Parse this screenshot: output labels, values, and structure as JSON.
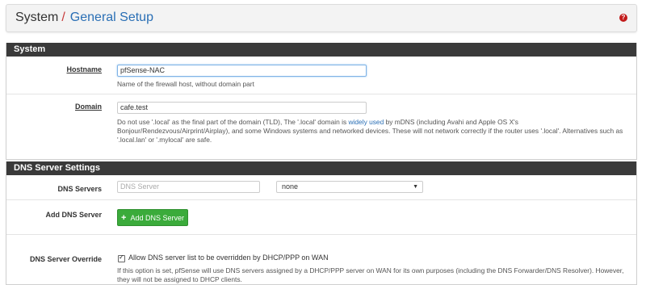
{
  "breadcrumb": {
    "root": "System",
    "separator": "/",
    "current": "General Setup"
  },
  "help_icon": "question-circle-icon",
  "system": {
    "heading": "System",
    "hostname": {
      "label": "Hostname",
      "value": "pfSense-NAC",
      "help": "Name of the firewall host, without domain part"
    },
    "domain": {
      "label": "Domain",
      "value": "cafe.test",
      "help_before_link": "Do not use '.local' as the final part of the domain (TLD), The '.local' domain is ",
      "help_link": "widely used",
      "help_after_link": " by mDNS (including Avahi and Apple OS X's Bonjour/Rendezvous/Airprint/Airplay), and some Windows systems and networked devices. These will not network correctly if the router uses '.local'. Alternatives such as '.local.lan' or '.mylocal' are safe."
    }
  },
  "dns": {
    "heading": "DNS Server Settings",
    "servers_label": "DNS Servers",
    "server_placeholder": "DNS Server",
    "gateway_selected": "none",
    "add_label": "Add DNS Server",
    "add_button": "Add DNS Server",
    "override_label": "DNS Server Override",
    "override_checked": true,
    "override_checkbox_label": "Allow DNS server list to be overridden by DHCP/PPP on WAN",
    "override_help": "If this option is set, pfSense will use DNS servers assigned by a DHCP/PPP server on WAN for its own purposes (including the DNS Forwarder/DNS Resolver). However, they will not be assigned to DHCP clients."
  }
}
